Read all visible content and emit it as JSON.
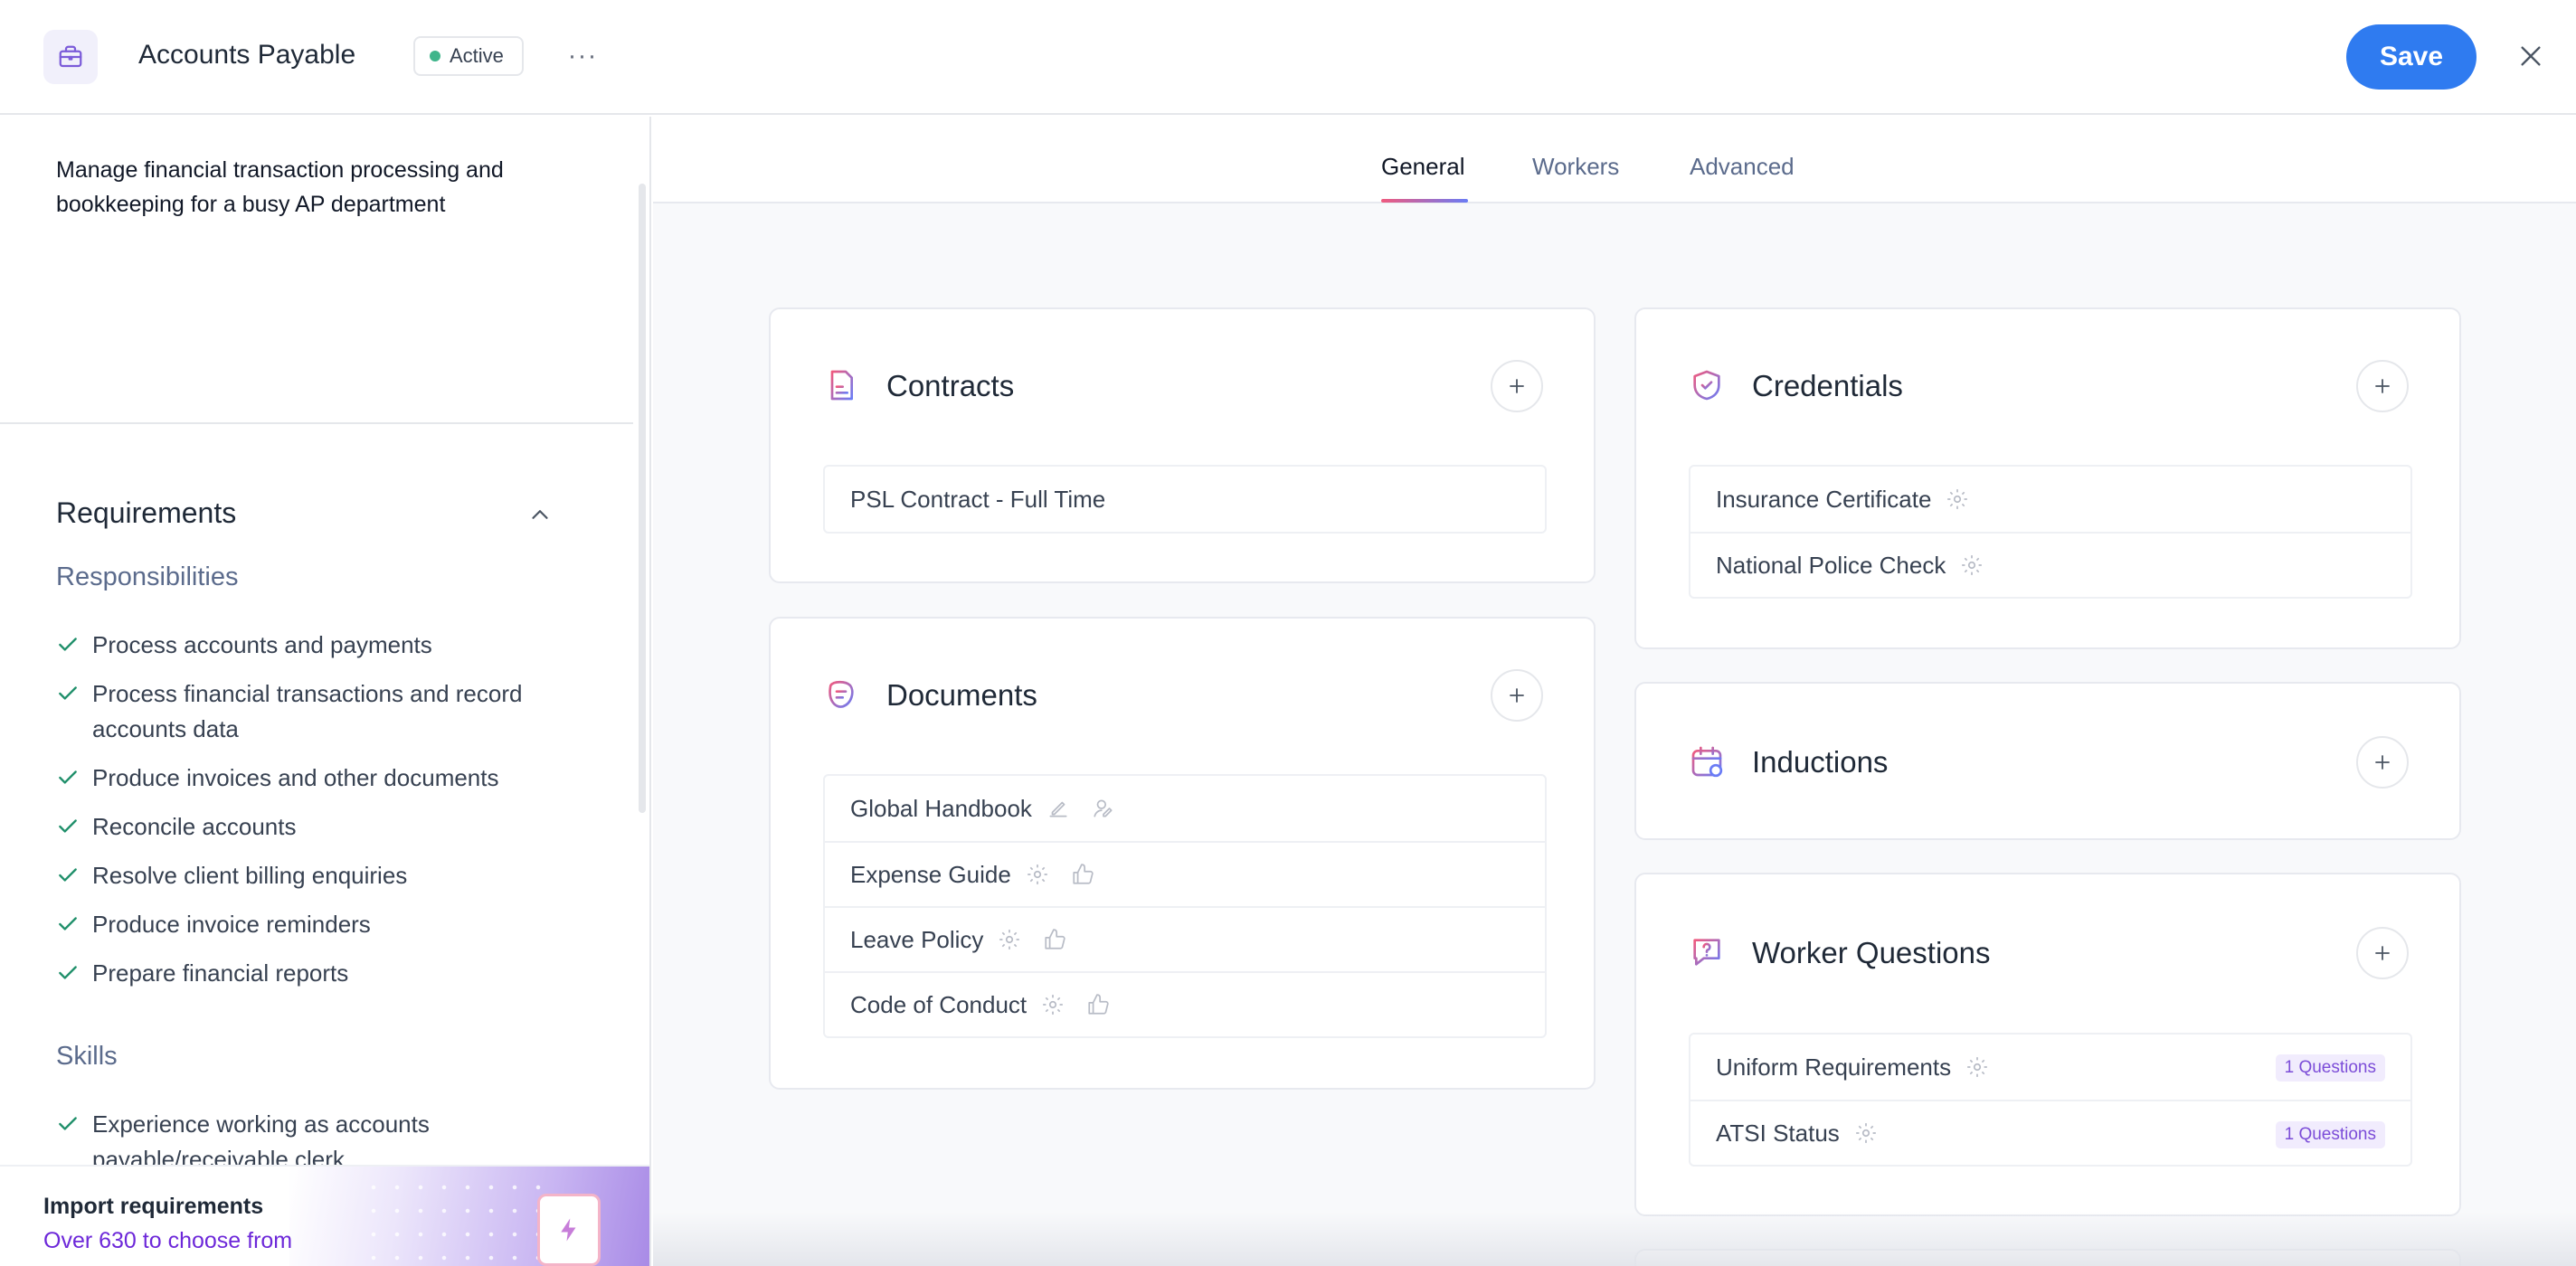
{
  "header": {
    "title": "Accounts Payable",
    "status": "Active",
    "more_label": "···",
    "save_label": "Save"
  },
  "sidebar": {
    "description": "Manage financial transaction processing and bookkeeping for a busy AP department",
    "requirements_title": "Requirements",
    "responsibilities_title": "Responsibilities",
    "responsibilities": [
      "Process accounts and payments",
      "Process financial transactions and record accounts data",
      "Produce invoices and other documents",
      "Reconcile accounts",
      "Resolve client billing enquiries",
      "Produce invoice reminders",
      "Prepare financial reports"
    ],
    "skills_title": "Skills",
    "skills": [
      "Experience working as accounts payable/receivable clerk"
    ],
    "import": {
      "title": "Import requirements",
      "subtitle": "Over 630 to choose from"
    }
  },
  "tabs": [
    {
      "label": "General",
      "active": true
    },
    {
      "label": "Workers",
      "active": false
    },
    {
      "label": "Advanced",
      "active": false
    }
  ],
  "cards": {
    "contracts": {
      "title": "Contracts",
      "items": [
        "PSL Contract - Full Time"
      ]
    },
    "documents": {
      "title": "Documents",
      "items": [
        "Global Handbook",
        "Expense Guide",
        "Leave Policy",
        "Code of Conduct"
      ]
    },
    "credentials": {
      "title": "Credentials",
      "items": [
        "Insurance Certificate",
        "National Police Check"
      ]
    },
    "inductions": {
      "title": "Inductions"
    },
    "worker_questions": {
      "title": "Worker Questions",
      "items": [
        {
          "label": "Uniform Requirements",
          "badge": "1 Questions"
        },
        {
          "label": "ATSI Status",
          "badge": "1 Questions"
        }
      ]
    }
  },
  "colors": {
    "primary": "#2f7bf0",
    "status_active": "#3fb58b",
    "accent_purple": "#6d28d9",
    "tab_gradient_start": "#f05a7e",
    "tab_gradient_end": "#6a7cf5"
  },
  "icons": [
    "briefcase-icon",
    "more-icon",
    "close-icon",
    "chevron-up-icon",
    "check-icon",
    "contract-icon",
    "documents-icon",
    "shield-icon",
    "calendar-icon",
    "question-icon",
    "plus-icon",
    "pencil-icon",
    "user-sign-icon",
    "settings-icon",
    "thumbs-up-icon",
    "lightning-icon"
  ]
}
